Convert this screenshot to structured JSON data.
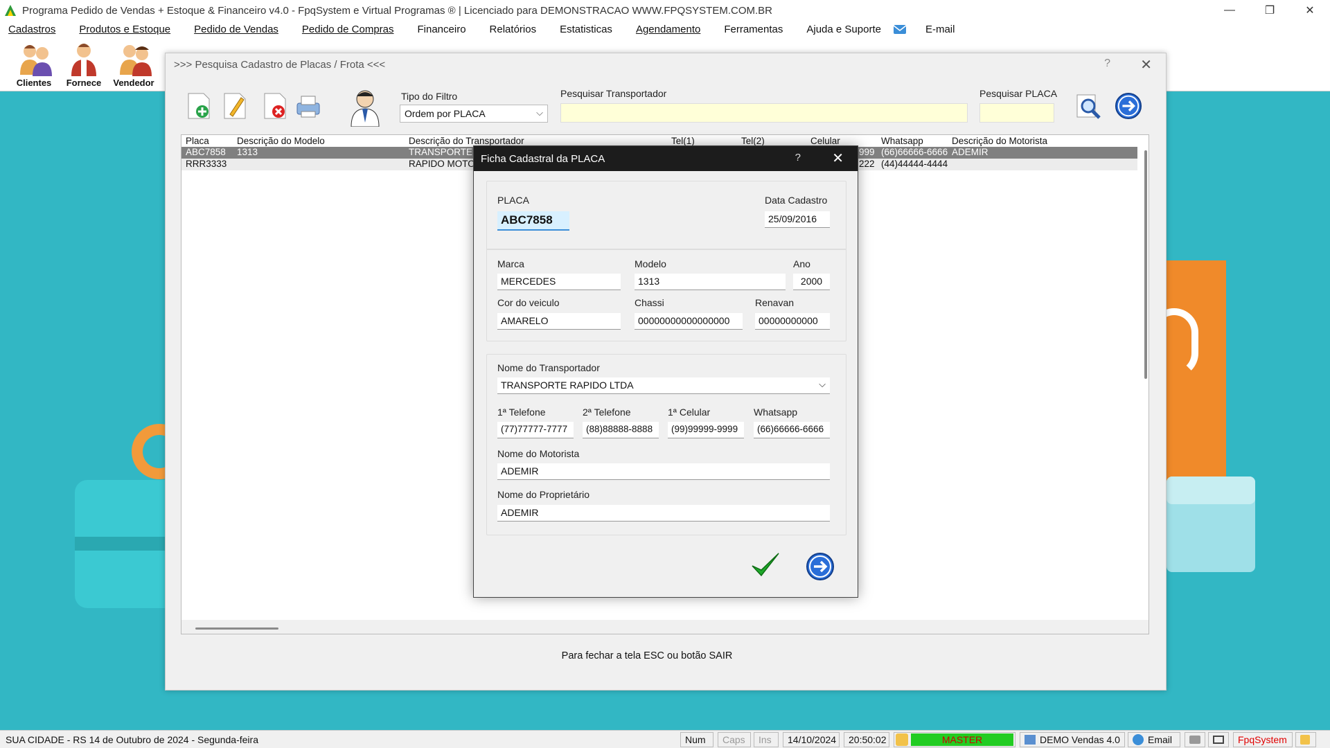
{
  "window": {
    "title": "Programa Pedido de Vendas + Estoque & Financeiro v4.0 - FpqSystem e Virtual Programas ® | Licenciado para  DEMONSTRACAO WWW.FPQSYSTEM.COM.BR"
  },
  "menu": [
    "Cadastros",
    "Produtos e Estoque",
    "Pedido de Vendas",
    "Pedido de Compras",
    "Financeiro",
    "Relatórios",
    "Estatisticas",
    "Agendamento",
    "Ferramentas",
    "Ajuda e Suporte",
    "E-mail"
  ],
  "toolbar": {
    "clientes": "Clientes",
    "fornece": "Fornece",
    "vendedor": "Vendedor"
  },
  "search_window": {
    "title": ">>> Pesquisa Cadastro de Placas / Frota <<<",
    "help": "?",
    "close": "✕",
    "filter_label": "Tipo do Filtro",
    "filter_value": "Ordem por PLACA",
    "transportador_label": "Pesquisar Transportador",
    "transportador_value": "",
    "placa_label": "Pesquisar PLACA",
    "placa_value": "",
    "footer": "Para fechar a tela ESC ou botão SAIR"
  },
  "grid": {
    "columns": [
      "Placa",
      "Descrição do Modelo",
      "Descrição do Transportador",
      "Tel(1)",
      "Tel(2)",
      "Celular",
      "Whatsapp",
      "Descrição do Motorista"
    ],
    "rows": [
      {
        "placa": "ABC7858",
        "modelo": "1313",
        "transportador": "TRANSPORTE",
        "celular": "999",
        "whatsapp": "(66)66666-6666",
        "motorista": "ADEMIR"
      },
      {
        "placa": "RRR3333",
        "modelo": "",
        "transportador": "RAPIDO MOTO",
        "celular": "222",
        "whatsapp": "(44)44444-4444",
        "motorista": ""
      }
    ]
  },
  "dialog": {
    "title": "Ficha Cadastral da PLACA",
    "help": "?",
    "close": "✕",
    "placa_label": "PLACA",
    "placa": "ABC7858",
    "data_label": "Data Cadastro",
    "data": "25/09/2016",
    "marca_label": "Marca",
    "marca": "MERCEDES",
    "modelo_label": "Modelo",
    "modelo": "1313",
    "ano_label": "Ano",
    "ano": "2000",
    "cor_label": "Cor do veiculo",
    "cor": "AMARELO",
    "chassi_label": "Chassi",
    "chassi": "00000000000000000",
    "renavan_label": "Renavan",
    "renavan": "00000000000",
    "transportador_label": "Nome do Transportador",
    "transportador": "TRANSPORTE RAPIDO LTDA",
    "tel1_label": "1ª Telefone",
    "tel1": "(77)77777-7777",
    "tel2_label": "2ª Telefone",
    "tel2": "(88)88888-8888",
    "cel_label": "1ª Celular",
    "cel": "(99)99999-9999",
    "whats_label": "Whatsapp",
    "whats": "(66)66666-6666",
    "motorista_label": "Nome do Motorista",
    "motorista": "ADEMIR",
    "proprietario_label": "Nome do Proprietário",
    "proprietario": "ADEMIR"
  },
  "statusbar": {
    "location": "SUA CIDADE - RS 14 de Outubro de 2024 - Segunda-feira",
    "num": "Num",
    "caps": "Caps",
    "ins": "Ins",
    "date": "14/10/2024",
    "time": "20:50:02",
    "user": "MASTER",
    "version": "DEMO Vendas 4.0",
    "email": "Email",
    "brand": "FpqSystem"
  },
  "colors": {
    "background": "#32b7c4",
    "input_highlight": "#ffffd8",
    "master_bg": "#22cc22",
    "brand_red": "#e00000"
  }
}
